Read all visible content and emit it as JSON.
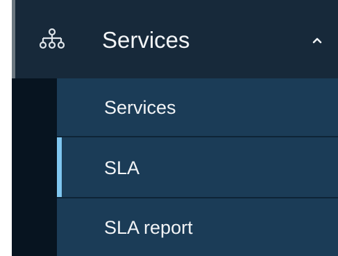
{
  "menu": {
    "header": {
      "label": "Services",
      "icon": "network-icon",
      "expanded": true,
      "chevron": "chevron-up-icon"
    },
    "items": [
      {
        "label": "Services",
        "active": false
      },
      {
        "label": "SLA",
        "active": true
      },
      {
        "label": "SLA report",
        "active": false
      }
    ]
  },
  "colors": {
    "header_background": "#17293a",
    "submenu_background": "#1b3c57",
    "gutter": "#071420",
    "active_indicator": "#7fc6f0",
    "text": "#f3f5f7"
  }
}
